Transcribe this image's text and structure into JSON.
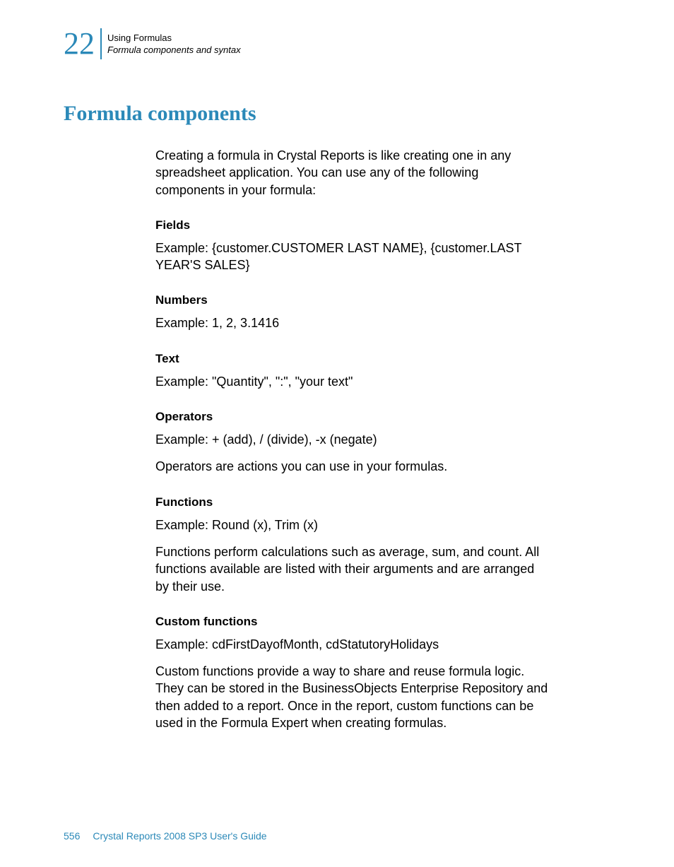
{
  "header": {
    "chapter_number": "22",
    "line1": "Using Formulas",
    "line2": "Formula components and syntax"
  },
  "main_heading": "Formula components",
  "intro": "Creating a formula in Crystal Reports is like creating one in any spreadsheet application. You can use any of the following components in your formula:",
  "sections": {
    "fields": {
      "heading": "Fields",
      "example": "Example: {customer.CUSTOMER LAST NAME}, {customer.LAST YEAR'S SALES}"
    },
    "numbers": {
      "heading": "Numbers",
      "example": "Example: 1, 2, 3.1416"
    },
    "text": {
      "heading": "Text",
      "example": "Example: \"Quantity\", \":\", \"your text\""
    },
    "operators": {
      "heading": "Operators",
      "example": "Example: + (add), / (divide), -x (negate)",
      "description": "Operators are actions you can use in your formulas."
    },
    "functions": {
      "heading": "Functions",
      "example": "Example: Round (x), Trim (x)",
      "description": "Functions perform calculations such as average, sum, and count. All functions available are listed with their arguments and are arranged by their use."
    },
    "custom_functions": {
      "heading": "Custom functions",
      "example": "Example: cdFirstDayofMonth, cdStatutoryHolidays",
      "description": "Custom functions provide a way to share and reuse formula logic. They can be stored in the BusinessObjects Enterprise Repository and then added to a report. Once in the report, custom functions can be used in the Formula Expert when creating formulas."
    }
  },
  "footer": {
    "page_number": "556",
    "title": "Crystal Reports 2008 SP3 User's Guide"
  }
}
